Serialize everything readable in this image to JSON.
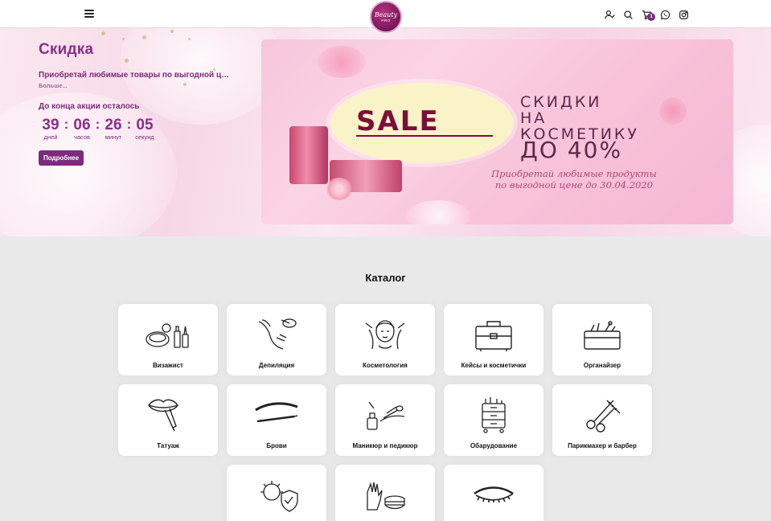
{
  "header": {
    "logo_line1": "Beauty",
    "logo_line2": "PRO",
    "cart_count": "1",
    "icons": [
      "menu-icon",
      "user-check-icon",
      "search-icon",
      "cart-icon",
      "whatsapp-icon",
      "instagram-icon"
    ]
  },
  "promo": {
    "title": "Скидка",
    "text": "Приобретай любимые товары по выгодной це...",
    "more_link": "Больше...",
    "countdown_label": "До конца акции осталось",
    "countdown": {
      "days": "39",
      "days_label": "дней",
      "hours": "06",
      "hours_label": "часов",
      "minutes": "26",
      "minutes_label": "минут",
      "seconds": "05",
      "seconds_label": "секунд"
    },
    "button": "Подробнее"
  },
  "banner": {
    "sale": "SALE",
    "headline1": "СКИДКИ",
    "headline2": "НА",
    "headline3": "КОСМЕТИКУ",
    "headline4": "ДО 40%",
    "subline1": "Приобретай любимые продукты",
    "subline2": "по выгодной цене до 30.04.2020"
  },
  "catalog": {
    "title": "Каталог",
    "items": [
      {
        "label": "Визажист",
        "icon": "makeup-icon"
      },
      {
        "label": "Депиляция",
        "icon": "depilation-icon"
      },
      {
        "label": "Косметология",
        "icon": "cosmetology-icon"
      },
      {
        "label": "Кейсы и косметички",
        "icon": "case-icon"
      },
      {
        "label": "Органайзер",
        "icon": "organizer-icon"
      },
      {
        "label": "Татуаж",
        "icon": "lips-tattoo-icon"
      },
      {
        "label": "Брови",
        "icon": "eyebrow-icon"
      },
      {
        "label": "Маникюр и педикюр",
        "icon": "manicure-icon"
      },
      {
        "label": "Обарудование",
        "icon": "equipment-icon"
      },
      {
        "label": "Парикмахер и барбер",
        "icon": "scissors-comb-icon"
      },
      {
        "label": "",
        "icon": "disinfection-icon"
      },
      {
        "label": "",
        "icon": "gloves-mask-icon"
      },
      {
        "label": "",
        "icon": "eyelash-icon"
      }
    ]
  },
  "colors": {
    "brand": "#8b2d8b",
    "button": "#7e2a7e",
    "background": "#e9e9e9"
  }
}
